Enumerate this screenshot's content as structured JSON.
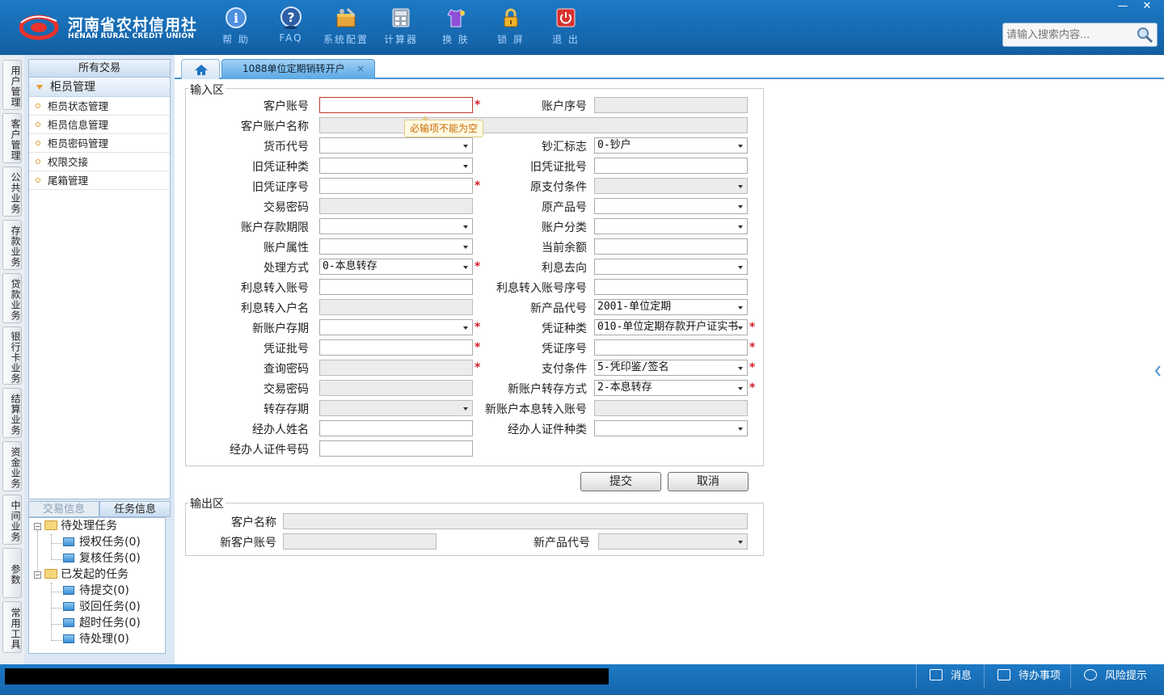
{
  "header": {
    "logo_cn": "河南省农村信用社",
    "logo_en": "HENAN RURAL CREDIT UNION",
    "toolbar": [
      {
        "label": "帮 助",
        "icon": "help-icon"
      },
      {
        "label": "FAQ",
        "icon": "faq-icon"
      },
      {
        "label": "系统配置",
        "icon": "config-icon"
      },
      {
        "label": "计算器",
        "icon": "calculator-icon"
      },
      {
        "label": "换 肤",
        "icon": "skin-icon"
      },
      {
        "label": "锁 屏",
        "icon": "lock-icon"
      },
      {
        "label": "退 出",
        "icon": "power-icon"
      }
    ],
    "window": {
      "minimize": "—",
      "close": "✕"
    },
    "search": {
      "placeholder": "请输入搜索内容..."
    }
  },
  "vertical_tabs": [
    "用户管理",
    "客户管理",
    "公共业务",
    "存款业务",
    "贷款业务",
    "银行卡业务",
    "结算业务",
    "资金业务",
    "中间业务",
    "参数",
    "常用工具"
  ],
  "left_panel": {
    "title": "所有交易",
    "group": "柜员管理",
    "items": [
      "柜员状态管理",
      "柜员信息管理",
      "柜员密码管理",
      "权限交接",
      "尾箱管理"
    ],
    "task_tabs": {
      "inactive": "交易信息",
      "active": "任务信息"
    },
    "tree": {
      "pending": "待处理任务",
      "authorize": "授权任务(0)",
      "review": "复核任务(0)",
      "initiated": "已发起的任务",
      "to_submit": "待提交(0)",
      "rejected": "驳回任务(0)",
      "timeout": "超时任务(0)",
      "to_process": "待处理(0)"
    }
  },
  "tabs": {
    "active": "1088单位定期销转开户",
    "close": "×"
  },
  "input_area": {
    "legend": "输入区",
    "labels": {
      "cust_acct": "客户账号",
      "acct_seq": "账户序号",
      "cust_acct_name": "客户账户名称",
      "currency": "货币代号",
      "cash_flag": "钞汇标志",
      "old_voucher_type": "旧凭证种类",
      "old_voucher_batch": "旧凭证批号",
      "old_voucher_seq": "旧凭证序号",
      "orig_pay_cond": "原支付条件",
      "trade_pwd": "交易密码",
      "orig_product": "原产品号",
      "deposit_term": "账户存款期限",
      "acct_class": "账户分类",
      "acct_attr": "账户属性",
      "curr_balance": "当前余额",
      "process_mode": "处理方式",
      "interest_dest": "利息去向",
      "interest_acct": "利息转入账号",
      "interest_acct_seq": "利息转入账号序号",
      "interest_name": "利息转入户名",
      "new_product": "新产品代号",
      "new_term": "新账户存期",
      "voucher_type": "凭证种类",
      "voucher_batch": "凭证批号",
      "voucher_seq": "凭证序号",
      "query_pwd": "查询密码",
      "pay_cond": "支付条件",
      "trade_pwd2": "交易密码",
      "new_transfer_mode": "新账户转存方式",
      "transfer_term": "转存存期",
      "new_principal_acct": "新账户本息转入账号",
      "agent_name": "经办人姓名",
      "agent_id_type": "经办人证件种类",
      "agent_id_no": "经办人证件号码"
    },
    "values": {
      "cash_flag": "0-钞户",
      "process_mode": "0-本息转存",
      "new_product": "2001-单位定期",
      "voucher_type": "010-单位定期存款开户证实书",
      "pay_cond": "5-凭印鉴/签名",
      "new_transfer_mode": "2-本息转存"
    },
    "error_tip": "必输项不能为空",
    "required_mark": "*"
  },
  "buttons": {
    "submit": "提交",
    "cancel": "取消"
  },
  "output_area": {
    "legend": "输出区",
    "cust_name": "客户名称",
    "new_cust_acct": "新客户账号",
    "new_product": "新产品代号"
  },
  "statusbar": {
    "message": "消息",
    "todo": "待办事项",
    "risk": "风险提示"
  },
  "colors": {
    "header_blue": "#1667ad",
    "required_red": "#d0202a",
    "tip_orange": "#c76b00"
  }
}
